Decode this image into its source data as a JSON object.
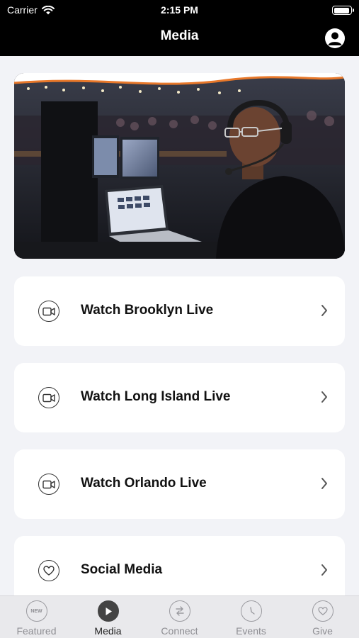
{
  "status_bar": {
    "carrier": "Carrier",
    "time": "2:15 PM"
  },
  "nav": {
    "title": "Media"
  },
  "menu": [
    {
      "label": "Watch Brooklyn Live",
      "icon": "video-camera-icon"
    },
    {
      "label": "Watch Long Island Live",
      "icon": "video-camera-icon"
    },
    {
      "label": "Watch Orlando Live",
      "icon": "video-camera-icon"
    },
    {
      "label": "Social Media",
      "icon": "heart-icon"
    }
  ],
  "tabs": [
    {
      "label": "Featured",
      "icon_text": "NEW",
      "active": false
    },
    {
      "label": "Media",
      "active": true
    },
    {
      "label": "Connect",
      "active": false
    },
    {
      "label": "Events",
      "active": false
    },
    {
      "label": "Give",
      "active": false
    }
  ],
  "colors": {
    "top_bar": "#000000",
    "background": "#f2f3f7",
    "card": "#ffffff",
    "hero_accent": "#e8782a"
  }
}
